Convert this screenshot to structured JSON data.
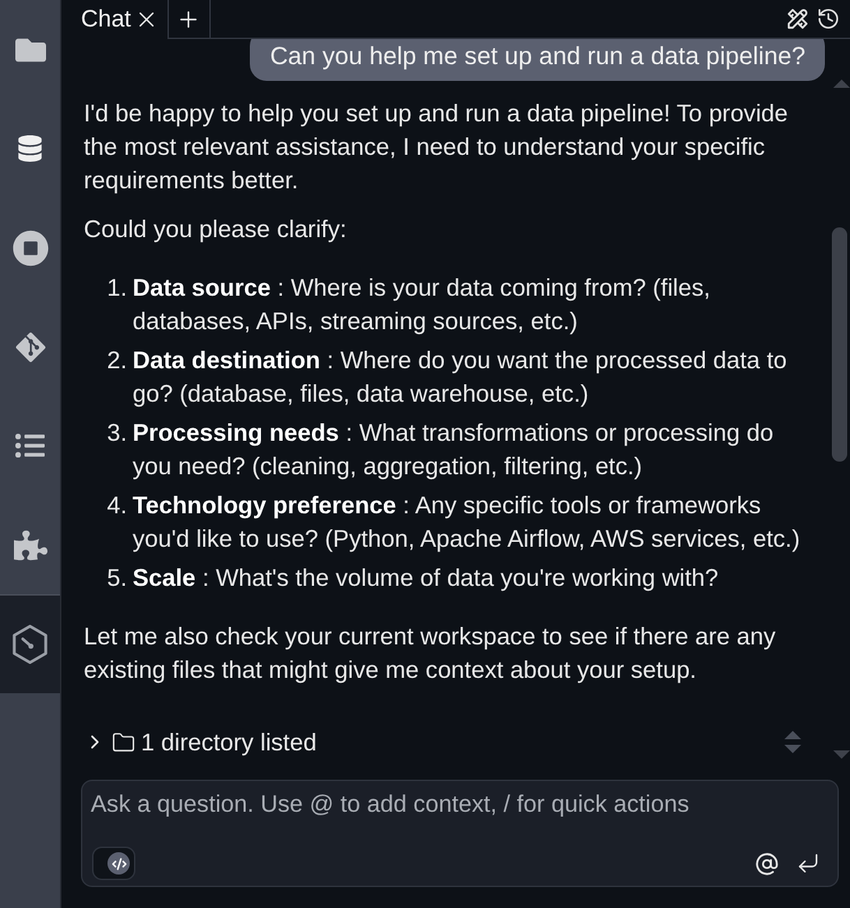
{
  "sidebar": {
    "items": [
      {
        "selected": false
      },
      {
        "selected": false
      },
      {
        "selected": false
      },
      {
        "selected": false
      },
      {
        "selected": false
      },
      {
        "selected": false
      },
      {
        "selected": true
      }
    ]
  },
  "tabs": [
    {
      "label": "Chat",
      "selected": true
    }
  ],
  "user_message": "Can you help me set up and run a data pipeline?",
  "response": [
    {
      "kind": "paragraph",
      "text": "I'd be happy to help you set up and run a data pipeline! To provide the most relevant assistance, I need to understand your specific requirements better."
    },
    {
      "kind": "paragraph",
      "text": "Could you please clarify:"
    },
    {
      "kind": "list",
      "items": [
        {
          "number": "1.",
          "text": "**Data source** : Where is your data coming from? (files, databases, APIs, streaming sources, etc.)"
        },
        {
          "number": "2.",
          "text": "**Data destination** : Where do you want the processed data to go? (database, files, data warehouse, etc.)"
        },
        {
          "number": "3.",
          "text": "**Processing needs** : What transformations or processing do you need? (cleaning, aggregation, filtering, etc.)"
        },
        {
          "number": "4.",
          "text": "**Technology preference** : Any specific tools or frameworks you'd like to use? (Python, Apache Airflow, AWS services, etc.)"
        },
        {
          "number": "5.",
          "text": "**Scale** : What's the volume of data you're working with?"
        }
      ]
    },
    {
      "kind": "paragraph",
      "text": "Let me also check your current workspace to see if there are any existing files that might give me context about your setup."
    }
  ],
  "tool_call": {
    "label": "1 directory listed",
    "expanded": false
  },
  "input": {
    "placeholder": "Ask a question. Use @ to add context, / for quick actions"
  }
}
